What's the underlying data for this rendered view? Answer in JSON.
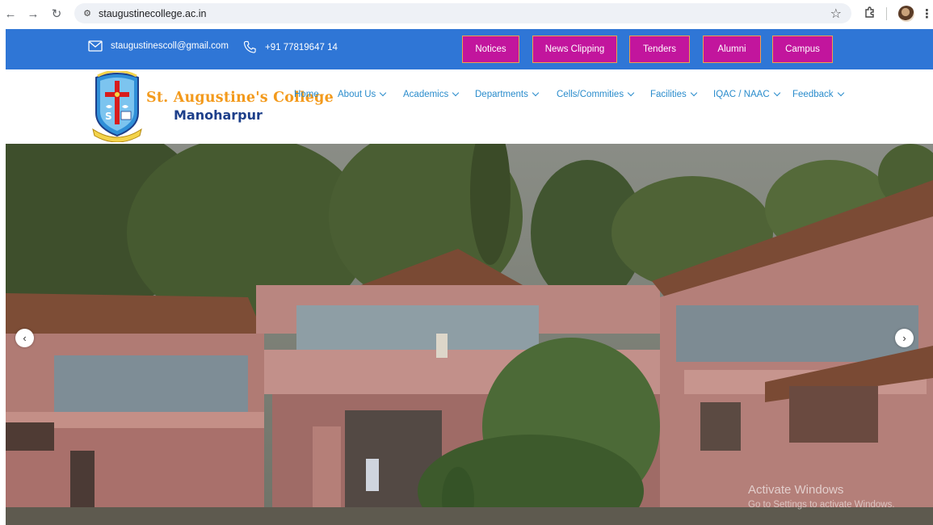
{
  "browser": {
    "url": "staugustinecollege.ac.in"
  },
  "topbar": {
    "email": "staugustinescoll@gmail.com",
    "phone": "+91 77819647 14",
    "buttons": [
      "Notices",
      "News Clipping",
      "Tenders",
      "Alumni",
      "Campus"
    ]
  },
  "brand": {
    "title": "St. Augustine's College",
    "subtitle": "Manoharpur"
  },
  "nav": {
    "items": [
      {
        "label": "Home"
      },
      {
        "label": "About Us"
      },
      {
        "label": "Academics"
      },
      {
        "label": "Departments"
      },
      {
        "label": "Cells/Commities"
      },
      {
        "label": "Facilities"
      },
      {
        "label": "IQAC / NAAC"
      },
      {
        "label": "Feedback"
      }
    ]
  },
  "hero": {
    "prev_icon": "chevron-left-icon",
    "next_icon": "chevron-right-icon"
  },
  "watermark": {
    "title": "Activate Windows",
    "subtitle": "Go to Settings to activate Windows."
  },
  "colors": {
    "topbar": "#2f76d6",
    "quick_button": "#c2159d",
    "quick_button_border": "#f0a04a",
    "nav_link": "#2a8ccc",
    "brand_orange": "#f39a1c",
    "brand_blue": "#1d3f8a"
  }
}
